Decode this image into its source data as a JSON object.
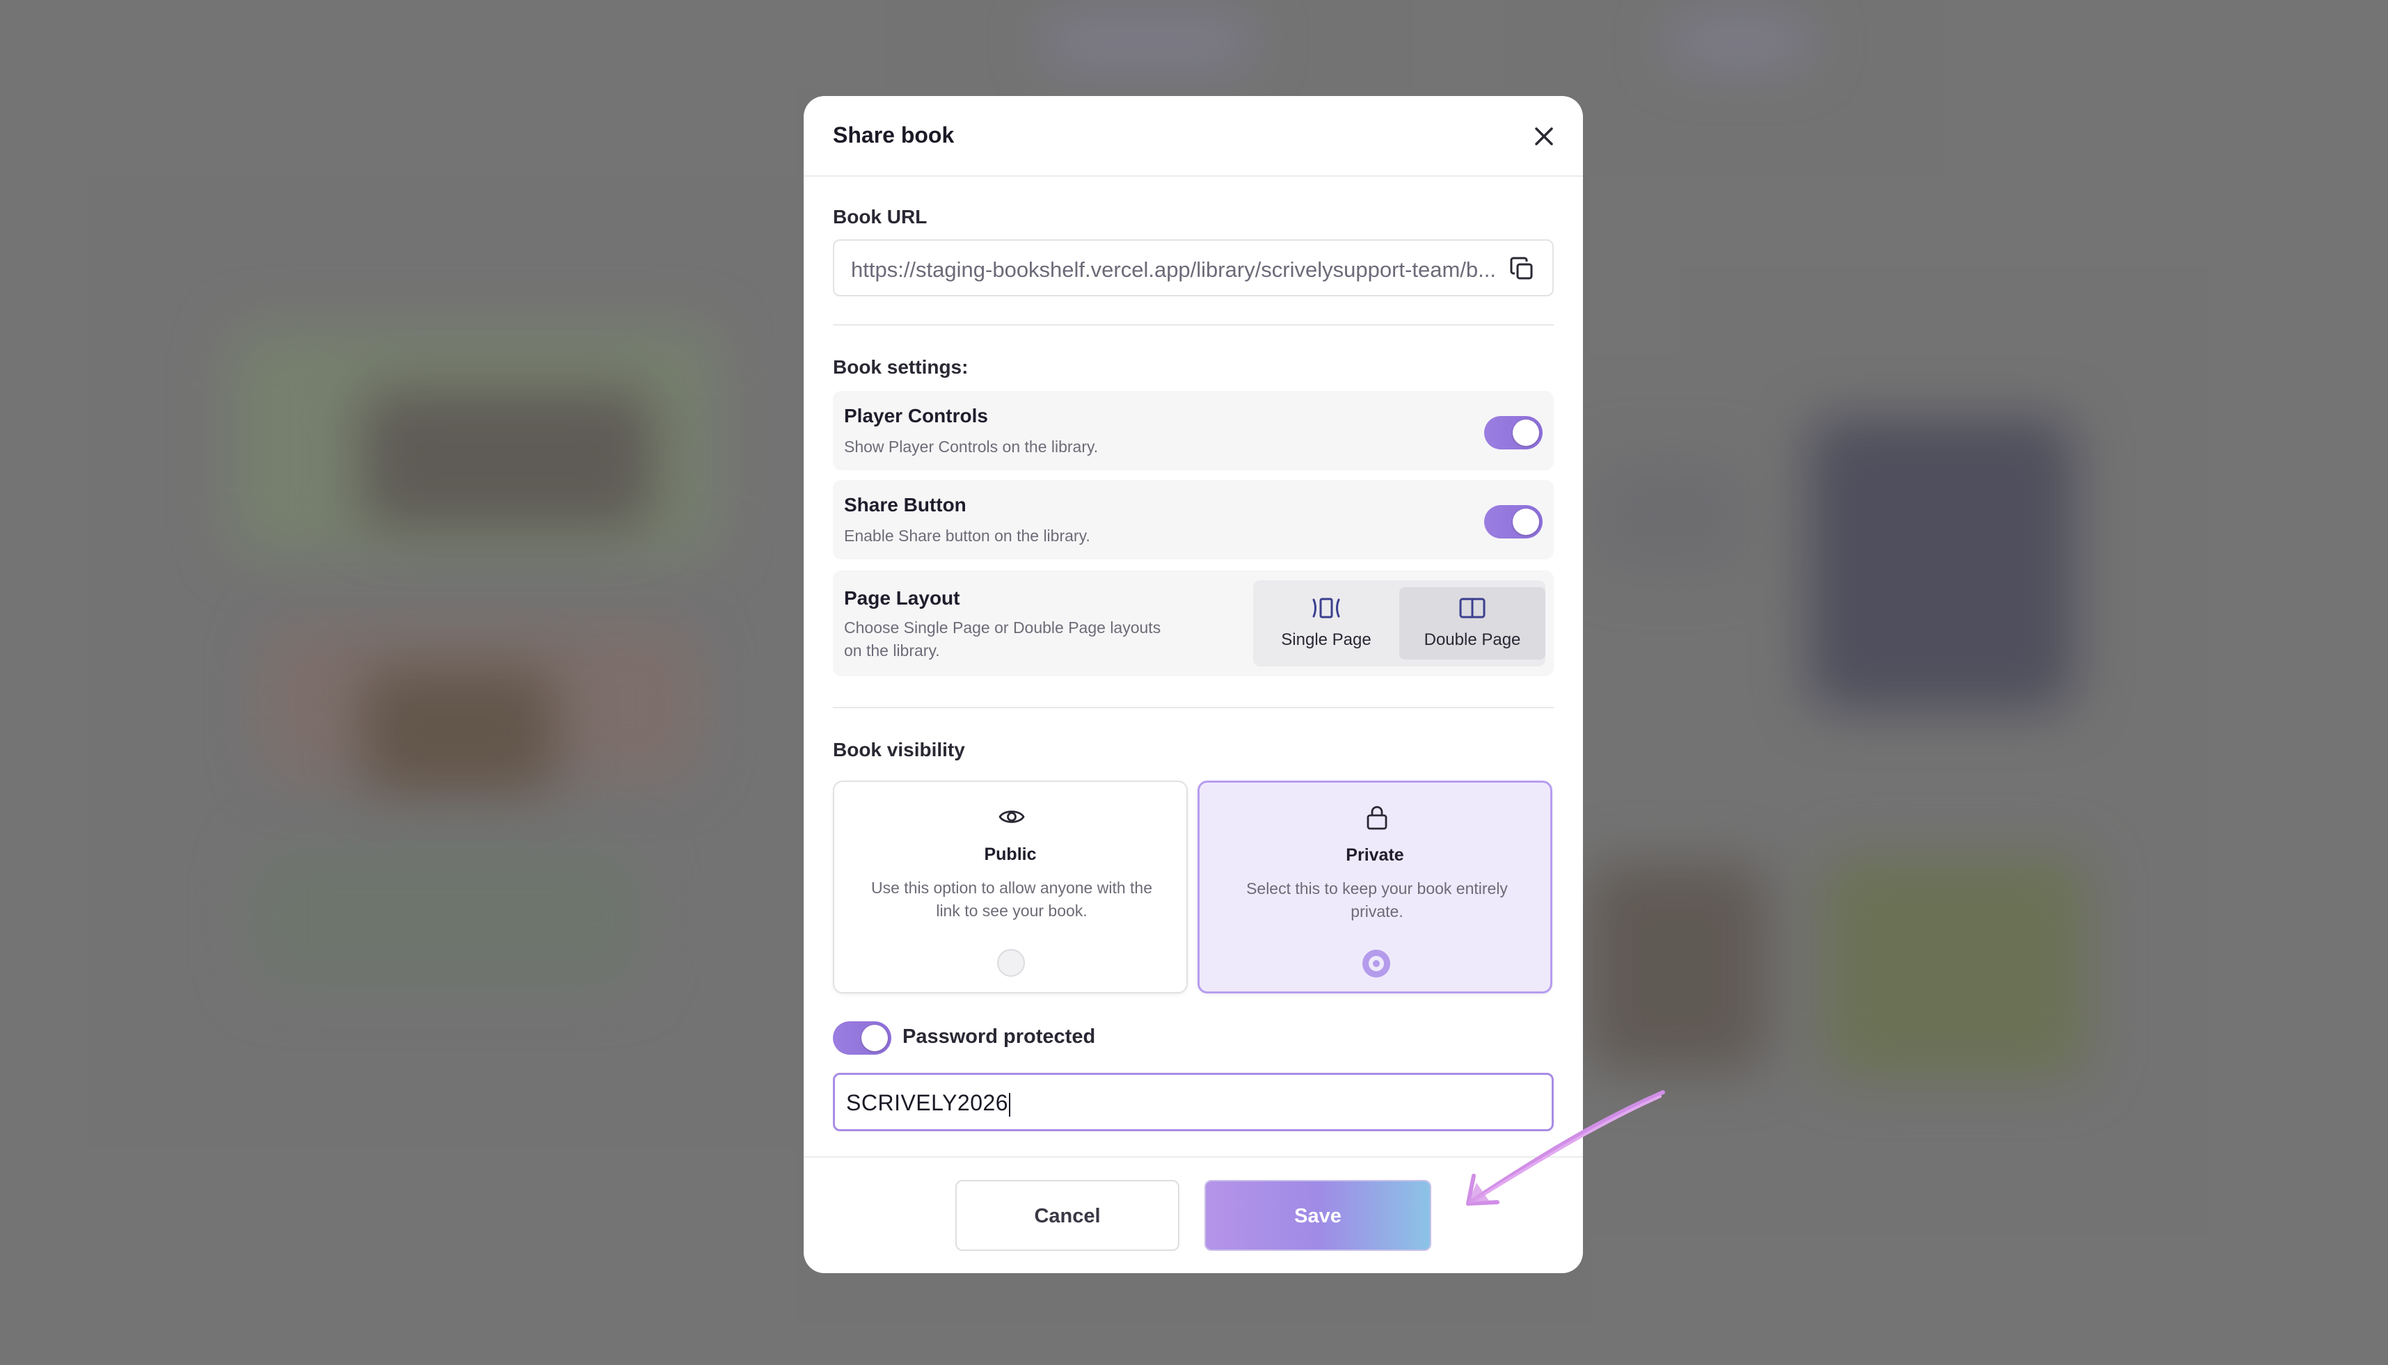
{
  "modal": {
    "title": "Share book"
  },
  "book_url": {
    "label": "Book URL",
    "value": "https://staging-bookshelf.vercel.app/library/scrivelysupport-team/b..."
  },
  "book_settings": {
    "heading": "Book settings:",
    "player_controls": {
      "title": "Player Controls",
      "description": "Show Player Controls on the library.",
      "enabled": true
    },
    "share_button": {
      "title": "Share Button",
      "description": "Enable Share button on the library.",
      "enabled": true
    },
    "page_layout": {
      "title": "Page Layout",
      "description": "Choose Single Page or Double Page layouts on the library.",
      "options": [
        "Single Page",
        "Double Page"
      ],
      "selected": "Double Page"
    }
  },
  "visibility": {
    "heading": "Book visibility",
    "public": {
      "title": "Public",
      "description": "Use this option to allow anyone with the link to see your book.",
      "icon": "eye-icon"
    },
    "private": {
      "title": "Private",
      "description": "Select this to keep your book entirely private.",
      "icon": "lock-icon"
    },
    "selected": "Private"
  },
  "password": {
    "label": "Password protected",
    "enabled": true,
    "value": "SCRIVELY2026"
  },
  "footer": {
    "cancel_label": "Cancel",
    "save_label": "Save"
  },
  "colors": {
    "accent": "#9b7ee0",
    "selected_card_bg": "#efeafb",
    "selected_card_border": "#b79df0"
  }
}
